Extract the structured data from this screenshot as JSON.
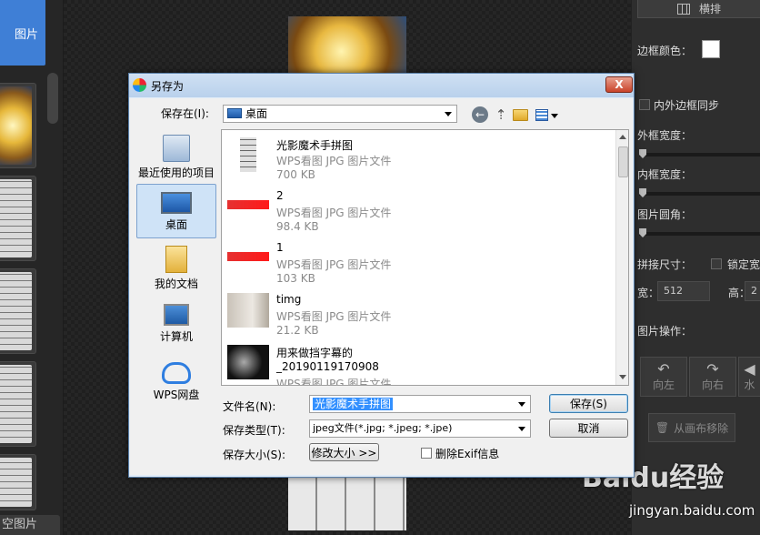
{
  "app": {
    "add_image_label": "图片",
    "bottom_left_label": "空图片",
    "arrange_label": "横排",
    "border_color_label": "边框颜色：",
    "sync_borders_label": "内外边框同步",
    "outer_width_label": "外框宽度：",
    "inner_width_label": "内框宽度：",
    "corner_radius_label": "图片圆角：",
    "canvas_size_label": "拼接尺寸：",
    "lock_ratio_label": "锁定宽",
    "width_label": "宽：",
    "width_value": "512",
    "height_label": "高：",
    "height_value": "2",
    "image_ops_label": "图片操作：",
    "rotate_left_label": "向左",
    "rotate_right_label": "向右",
    "mirror_label": "水",
    "remove_label": "从画布移除",
    "watermark_text": "Baidu经验",
    "watermark_url": "jingyan.baidu.com"
  },
  "dialog": {
    "title": "另存为",
    "close_label": "X",
    "save_in_label": "保存在(I):",
    "save_in_value": "桌面",
    "places": [
      {
        "label": "最近使用的项目"
      },
      {
        "label": "桌面"
      },
      {
        "label": "我的文档"
      },
      {
        "label": "计算机"
      },
      {
        "label": "WPS网盘"
      }
    ],
    "files": [
      {
        "name": "光影魔术手拼图",
        "type": "WPS看图 JPG 图片文件",
        "size": "700 KB"
      },
      {
        "name": "2",
        "type": "WPS看图 JPG 图片文件",
        "size": "98.4 KB"
      },
      {
        "name": "1",
        "type": "WPS看图 JPG 图片文件",
        "size": "103 KB"
      },
      {
        "name": "timg",
        "type": "WPS看图 JPG 图片文件",
        "size": "21.2 KB"
      },
      {
        "name": "用来做挡字幕的",
        "name2": "_20190119170908",
        "type": "WPS看图 JPG 图片文件"
      }
    ],
    "filename_label": "文件名(N):",
    "filename_value": "光影魔术手拼图",
    "filetype_label": "保存类型(T):",
    "filetype_value": "jpeg文件(*.jpg; *.jpeg; *.jpe)",
    "filesize_label": "保存大小(S):",
    "resize_label": "修改大小 >>",
    "strip_exif_label": "删除Exif信息",
    "save_label": "保存(S)",
    "cancel_label": "取消"
  }
}
